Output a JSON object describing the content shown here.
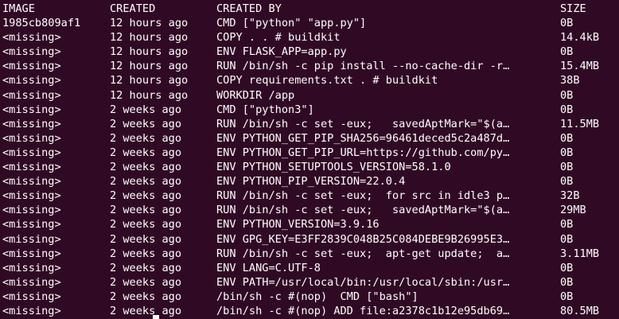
{
  "header": {
    "image": "IMAGE",
    "created": "CREATED",
    "created_by": "CREATED BY",
    "size": "SIZE"
  },
  "rows": [
    {
      "image": "1985cb809af1",
      "created": "12 hours ago",
      "created_by": "CMD [\"python\" \"app.py\"]",
      "size": "0B"
    },
    {
      "image": "<missing>",
      "created": "12 hours ago",
      "created_by": "COPY . . # buildkit",
      "size": "14.4kB"
    },
    {
      "image": "<missing>",
      "created": "12 hours ago",
      "created_by": "ENV FLASK_APP=app.py",
      "size": "0B"
    },
    {
      "image": "<missing>",
      "created": "12 hours ago",
      "created_by": "RUN /bin/sh -c pip install --no-cache-dir -r…",
      "size": "15.4MB"
    },
    {
      "image": "<missing>",
      "created": "12 hours ago",
      "created_by": "COPY requirements.txt . # buildkit",
      "size": "38B"
    },
    {
      "image": "<missing>",
      "created": "12 hours ago",
      "created_by": "WORKDIR /app",
      "size": "0B"
    },
    {
      "image": "<missing>",
      "created": "2 weeks ago",
      "created_by": "CMD [\"python3\"]",
      "size": "0B"
    },
    {
      "image": "<missing>",
      "created": "2 weeks ago",
      "created_by": "RUN /bin/sh -c set -eux;   savedAptMark=\"$(a…",
      "size": "11.5MB"
    },
    {
      "image": "<missing>",
      "created": "2 weeks ago",
      "created_by": "ENV PYTHON_GET_PIP_SHA256=96461deced5c2a487d…",
      "size": "0B"
    },
    {
      "image": "<missing>",
      "created": "2 weeks ago",
      "created_by": "ENV PYTHON_GET_PIP_URL=https://github.com/py…",
      "size": "0B"
    },
    {
      "image": "<missing>",
      "created": "2 weeks ago",
      "created_by": "ENV PYTHON_SETUPTOOLS_VERSION=58.1.0",
      "size": "0B"
    },
    {
      "image": "<missing>",
      "created": "2 weeks ago",
      "created_by": "ENV PYTHON_PIP_VERSION=22.0.4",
      "size": "0B"
    },
    {
      "image": "<missing>",
      "created": "2 weeks ago",
      "created_by": "RUN /bin/sh -c set -eux;  for src in idle3 p…",
      "size": "32B"
    },
    {
      "image": "<missing>",
      "created": "2 weeks ago",
      "created_by": "RUN /bin/sh -c set -eux;   savedAptMark=\"$(a…",
      "size": "29MB"
    },
    {
      "image": "<missing>",
      "created": "2 weeks ago",
      "created_by": "ENV PYTHON_VERSION=3.9.16",
      "size": "0B"
    },
    {
      "image": "<missing>",
      "created": "2 weeks ago",
      "created_by": "ENV GPG_KEY=E3FF2839C048B25C084DEBE9B26995E3…",
      "size": "0B"
    },
    {
      "image": "<missing>",
      "created": "2 weeks ago",
      "created_by": "RUN /bin/sh -c set -eux;  apt-get update;  a…",
      "size": "3.11MB"
    },
    {
      "image": "<missing>",
      "created": "2 weeks ago",
      "created_by": "ENV LANG=C.UTF-8",
      "size": "0B"
    },
    {
      "image": "<missing>",
      "created": "2 weeks ago",
      "created_by": "ENV PATH=/usr/local/bin:/usr/local/sbin:/usr…",
      "size": "0B"
    },
    {
      "image": "<missing>",
      "created": "2 weeks ago",
      "created_by": "/bin/sh -c #(nop)  CMD [\"bash\"]",
      "size": "0B"
    },
    {
      "image": "<missing>",
      "created": "2 weeks ago",
      "created_by": "/bin/sh -c #(nop) ADD file:a2378c1b12e95db69…",
      "size": "80.5MB"
    }
  ],
  "colors": {
    "background": "#300a24",
    "foreground": "#ffffff"
  }
}
